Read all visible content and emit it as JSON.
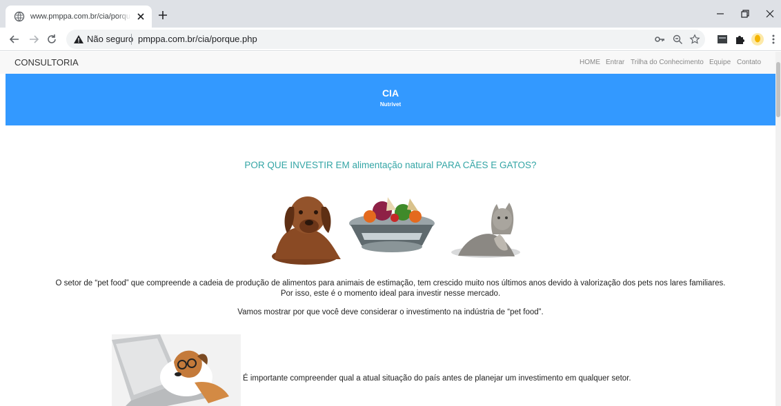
{
  "browser": {
    "tab_title": "www.pmppa.com.br/cia/porque.php",
    "security_label": "Não seguro",
    "url": "pmppa.com.br/cia/porque.php"
  },
  "site": {
    "brand": "CONSULTORIA",
    "menu": [
      "HOME",
      "Entrar",
      "Trilha do Conhecimento",
      "Equipe",
      "Contato"
    ]
  },
  "hero": {
    "title": "CIA",
    "subtitle": "Nutrivet"
  },
  "content": {
    "heading": "POR QUE INVESTIR EM alimentação natural PARA CÃES E GATOS?",
    "paragraph1_line1": "O setor de “pet food” que compreende a cadeia de produção de alimentos para animais de estimação, tem crescido muito nos últimos anos devido à valorização dos pets nos lares familiares.",
    "paragraph1_line2": "Por isso, este é o momento ideal para investir nesse mercado.",
    "paragraph2": "Vamos mostrar por que você deve considerar o investimento na indústria de “pet food”.",
    "paragraph3": "É importante compreender qual a atual situação do país antes de planejar um investimento em qualquer setor."
  },
  "colors": {
    "hero_bg": "#3399ff",
    "heading": "#33a5a5"
  }
}
